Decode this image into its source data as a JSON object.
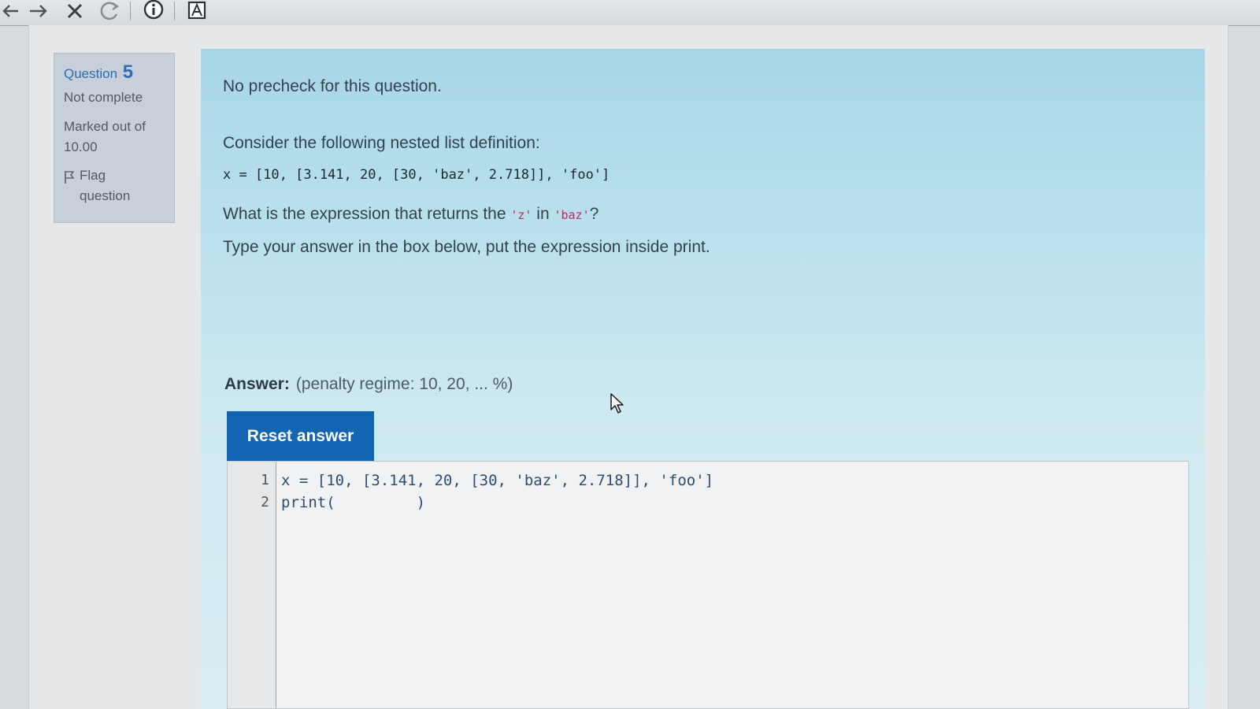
{
  "question": {
    "label": "Question",
    "number": "5",
    "state": "Not complete",
    "grade_label": "Marked out of",
    "grade_value": "10.00",
    "flag_line1": "Flag",
    "flag_line2": "question"
  },
  "content": {
    "precheck": "No precheck for this question.",
    "consider": "Consider the following nested list definition:",
    "code_definition": "x = [10, [3.141, 20, [30, 'baz', 2.718]], 'foo']",
    "what_prefix": "What is the expression that returns the ",
    "what_code1": "'z'",
    "what_mid": " in ",
    "what_code2": "'baz'",
    "what_suffix": "?",
    "instruction": "Type your answer in the box below, put the expression inside print."
  },
  "answer": {
    "label": "Answer:",
    "penalty": "(penalty regime: 10, 20, ... %)",
    "reset_label": "Reset answer"
  },
  "editor": {
    "line_numbers": [
      "1",
      "2"
    ],
    "lines": [
      "x = [10, [3.141, 20, [30, 'baz', 2.718]], 'foo']",
      "print(         )"
    ]
  },
  "icons": {
    "back": "arrow-left-icon",
    "forward": "arrow-right-icon",
    "stop": "close-icon",
    "reload": "reload-icon",
    "info": "info-icon",
    "reader": "reader-mode-icon",
    "flag": "flag-icon",
    "cursor": "mouse-pointer-icon"
  },
  "colors": {
    "accent": "#1265b2",
    "panel": "#bfe3ef",
    "info_box": "#c7d0da",
    "inline_code": "#c02a6a"
  }
}
